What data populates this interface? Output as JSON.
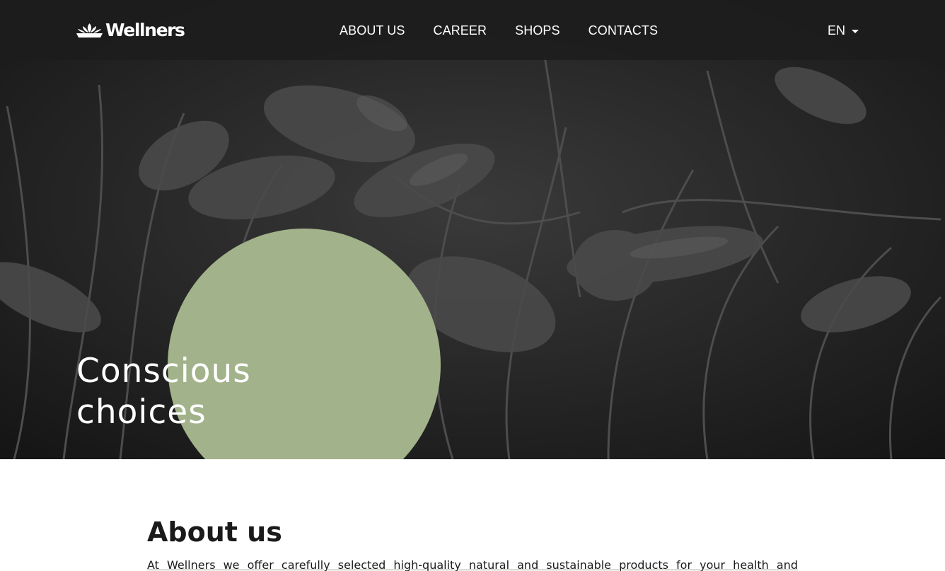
{
  "brand": {
    "name": "Wellners",
    "logo_icon": "lotus-icon"
  },
  "nav": {
    "items": [
      {
        "label": "ABOUT US"
      },
      {
        "label": "CAREER"
      },
      {
        "label": "SHOPS"
      },
      {
        "label": "CONTACTS"
      }
    ]
  },
  "language": {
    "selected": "EN",
    "icon": "caret-down-icon"
  },
  "hero": {
    "title_line1": "Conscious",
    "title_line2": "choices",
    "accent_color": "#a2b28a",
    "background_color": "#2b2b2b"
  },
  "about": {
    "title": "About us",
    "text": "At Wellners we offer carefully selected high-quality natural and sustainable products for your health and"
  },
  "colors": {
    "navbar": "#1c1c1c",
    "text_light": "#ffffff",
    "text_dark": "#1a1a1a"
  }
}
